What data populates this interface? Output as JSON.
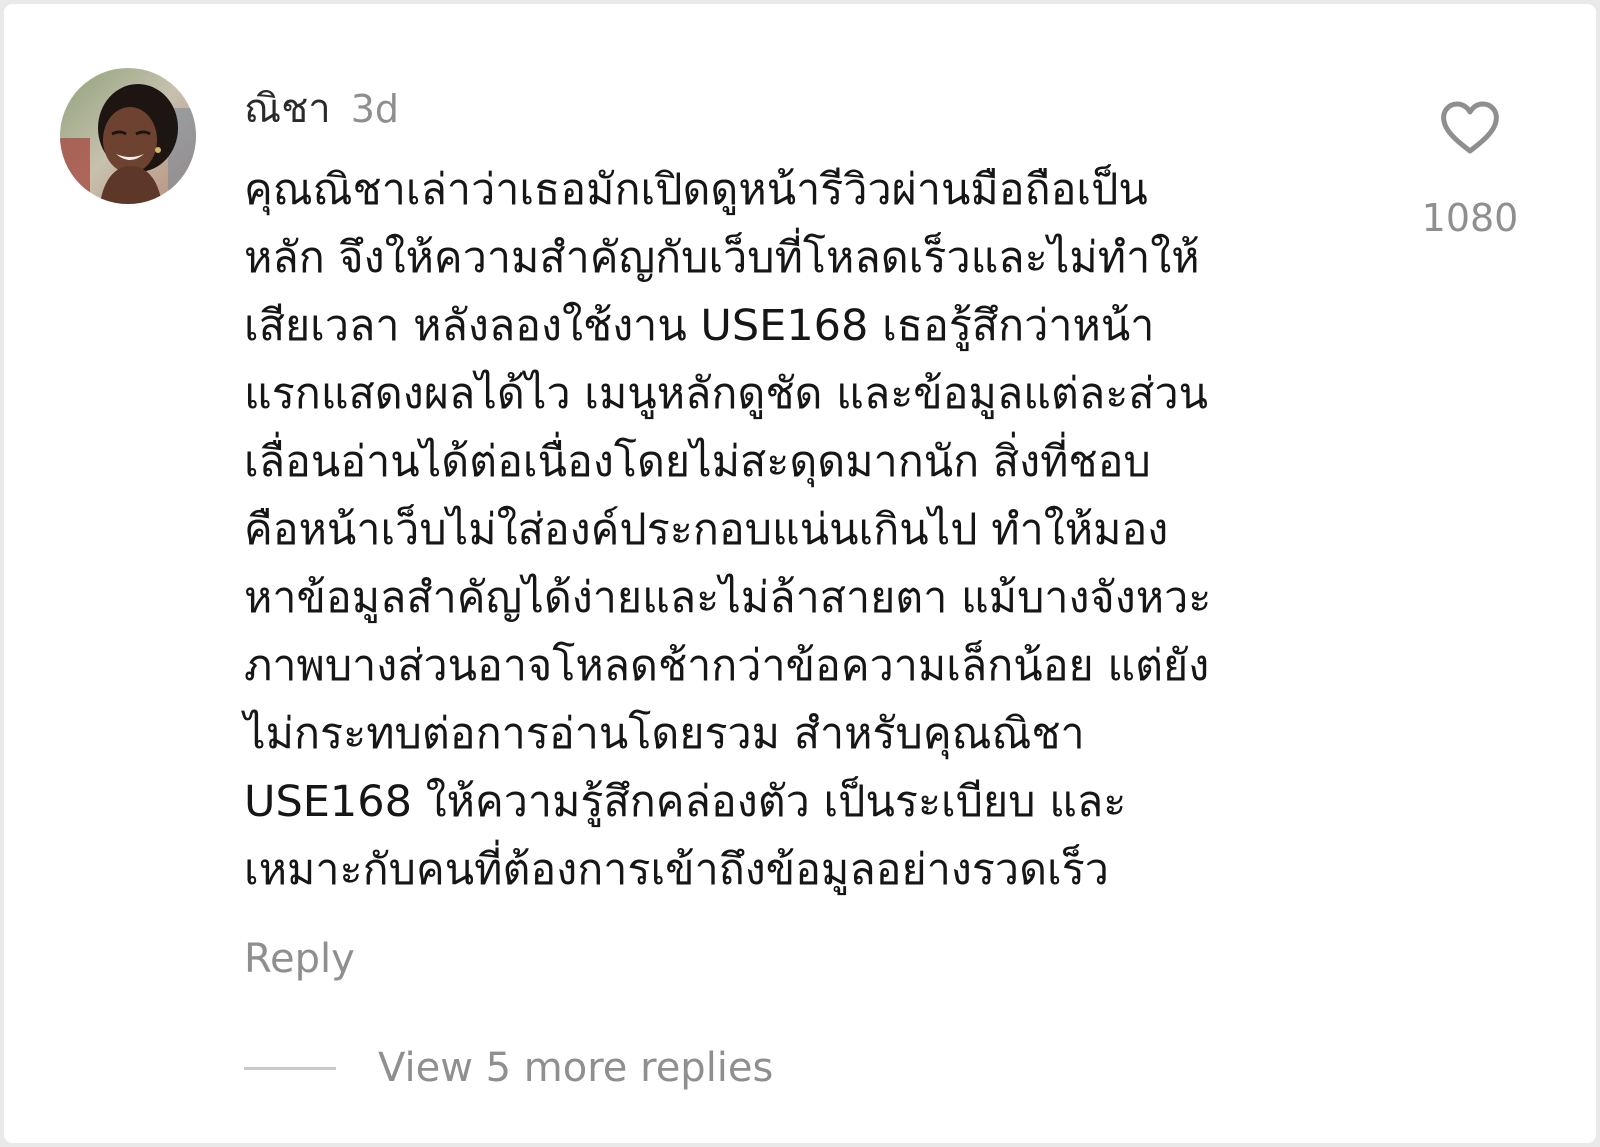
{
  "comment": {
    "username": "ณิชา",
    "time": "3d",
    "text_lines": [
      "คุณณิชาเล่าว่าเธอมักเปิดดูหน้ารีวิวผ่านมือถือเป็น",
      "หลัก จึงให้ความสำคัญกับเว็บที่โหลดเร็วและไม่ทำให้",
      "เสียเวลา หลังลองใช้งาน USE168 เธอรู้สึกว่าหน้า",
      "แรกแสดงผลได้ไว เมนูหลักดูชัด และข้อมูลแต่ละส่วน",
      "เลื่อนอ่านได้ต่อเนื่องโดยไม่สะดุดมากนัก สิ่งที่ชอบ",
      "คือหน้าเว็บไม่ใส่องค์ประกอบแน่นเกินไป ทำให้มอง",
      "หาข้อมูลสำคัญได้ง่ายและไม่ล้าสายตา แม้บางจังหวะ",
      "ภาพบางส่วนอาจโหลดช้ากว่าข้อความเล็กน้อย แต่ยัง",
      "ไม่กระทบต่อการอ่านโดยรวม สำหรับคุณณิชา",
      "USE168 ให้ความรู้สึกคล่องตัว เป็นระเบียบ และ",
      "เหมาะกับคนที่ต้องการเข้าถึงข้อมูลอย่างรวดเร็ว"
    ],
    "like_icon": "heart-outline-icon",
    "like_count": "1080",
    "reply_label": "Reply",
    "view_replies_label": "View 5 more replies"
  },
  "colors": {
    "text_primary": "#161616",
    "text_secondary": "#8f8f8f",
    "background": "#ffffff"
  }
}
